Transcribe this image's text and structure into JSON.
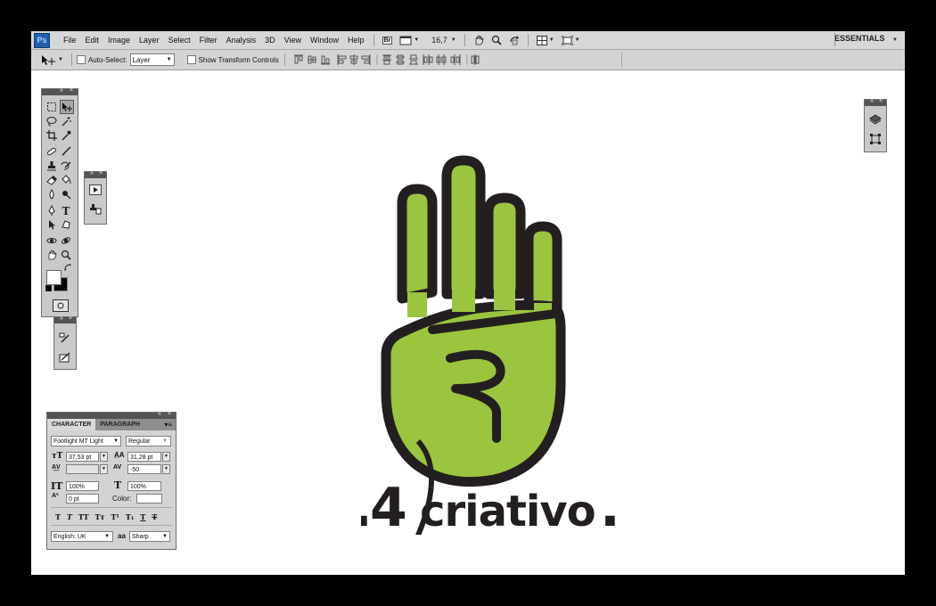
{
  "app": {
    "logo": "Ps",
    "workspace": "ESSENTIALS"
  },
  "menu": {
    "items": [
      "File",
      "Edit",
      "Image",
      "Layer",
      "Select",
      "Filter",
      "Analysis",
      "3D",
      "View",
      "Window",
      "Help"
    ]
  },
  "appbar": {
    "bridge": "Br",
    "zoom": "16,7"
  },
  "options": {
    "autoselect_label": "Auto-Select:",
    "autoselect_value": "Layer",
    "transform_label": "Show Transform Controls"
  },
  "character": {
    "tabs": [
      "CHARACTER",
      "PARAGRAPH"
    ],
    "font_family": "Footlight MT Light",
    "font_style": "Regular",
    "font_size": "37,53 pt",
    "leading": "31,28 pt",
    "kerning": "",
    "tracking": "-50",
    "vertical_scale": "100%",
    "horizontal_scale": "100%",
    "baseline_shift": "0 pt",
    "color_label": "Color:",
    "language": "English: UK",
    "antialias": "Sharp",
    "aa_label": "aa"
  },
  "artwork": {
    "prefix_dot": ".",
    "number": "4",
    "word": "criativo",
    "suffix_dot": ".",
    "hand_color": "#9bc53e",
    "outline_color": "#231f20"
  },
  "colors": {
    "chrome": "#d7d7d7",
    "panel": "#c9c9c9",
    "canvas": "#ffffff"
  }
}
